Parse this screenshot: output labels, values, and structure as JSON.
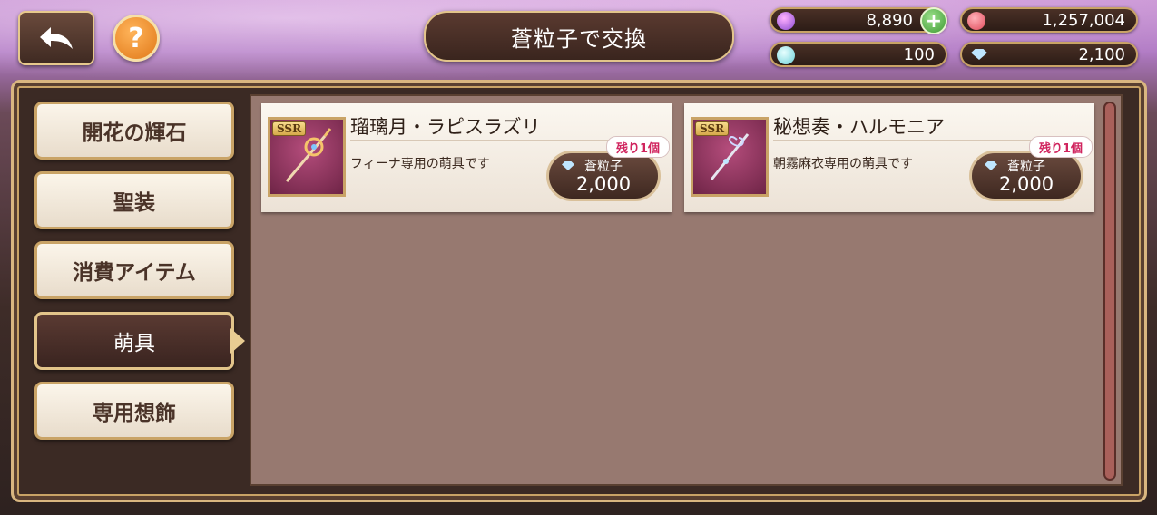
{
  "header": {
    "title": "蒼粒子で交換",
    "back_icon": "back-arrow-icon",
    "help_label": "?"
  },
  "currencies": [
    {
      "name": "purple-crystal",
      "value": "8,890",
      "color": "#8a4cd0"
    },
    {
      "name": "red-gem",
      "value": "1,257,004",
      "color": "#e04a5a"
    },
    {
      "name": "teal-orb",
      "value": "100",
      "color": "#6ad0d8"
    },
    {
      "name": "blue-particle",
      "value": "2,100",
      "color": "#bfe6ff"
    }
  ],
  "sidebar": {
    "items": [
      {
        "label": "開花の輝石",
        "active": false
      },
      {
        "label": "聖装",
        "active": false
      },
      {
        "label": "消費アイテム",
        "active": false
      },
      {
        "label": "萌具",
        "active": true
      },
      {
        "label": "専用想飾",
        "active": false
      }
    ]
  },
  "items": [
    {
      "rarity": "SSR",
      "name": "瑠璃月・ラピスラズリ",
      "description": "フィーナ専用の萌具です",
      "stock_badge": "残り1個",
      "currency_label": "蒼粒子",
      "price": "2,000"
    },
    {
      "rarity": "SSR",
      "name": "秘想奏・ハルモニア",
      "description": "朝霧麻衣専用の萌具です",
      "stock_badge": "残り1個",
      "currency_label": "蒼粒子",
      "price": "2,000"
    }
  ],
  "colors": {
    "accent_gold": "#d9b680",
    "badge_text": "#d0245e",
    "panel_bg": "#977970"
  }
}
